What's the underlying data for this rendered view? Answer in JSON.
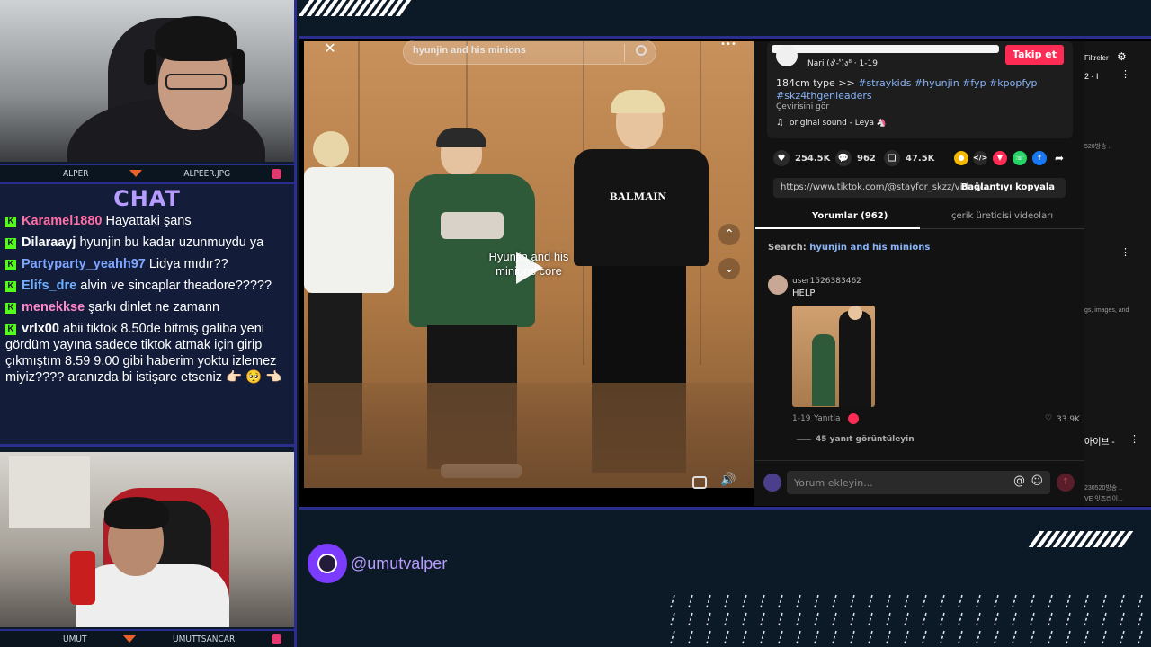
{
  "cams": {
    "top": {
      "left_label": "ALPER",
      "right_label": "ALPEER.JPG"
    },
    "bottom": {
      "left_label": "UMUT",
      "right_label": "UMUTTSANCAR"
    }
  },
  "chat": {
    "title": "CHAT",
    "messages": [
      {
        "user": "Karamel1880",
        "color": "#ff6fa5",
        "text": "Hayattaki şans"
      },
      {
        "user": "Dilaraayj",
        "color": "#ffffff",
        "text": "hyunjin bu kadar uzunmuydu ya"
      },
      {
        "user": "Partyparty_yeahh97",
        "color": "#7ea6ff",
        "text": "Lidya mıdır??"
      },
      {
        "user": "Elifs_dre",
        "color": "#6fb0ff",
        "text": "alvin ve sincaplar theadore?????"
      },
      {
        "user": "menekkse",
        "color": "#ff88c8",
        "text": "şarkı dinlet ne zamann"
      },
      {
        "user": "vrlx00",
        "color": "#ffffff",
        "text": "abii tiktok 8.50de bitmiş galiba yeni gördüm yayına sadece tiktok atmak için girip çıkmıştım 8.59 9.00 gibi haberim yoktu izlemez miyiz???? aranızda bi istişare etseniz 👉🏻 🥺 👈🏻"
      }
    ]
  },
  "video": {
    "search_text": "hyunjin and his minions",
    "caption": "Hyunjin and his minions core",
    "close_glyph": "✕",
    "more_glyph": "•••"
  },
  "tiktok": {
    "author_meta": "Nari (ง'̀-'́)ง⁸ · 1-19",
    "follow_label": "Takip et",
    "description_text": "184cm type >> ",
    "hashtags_line1": "#straykids #hyunjin #fyp #kpopfyp",
    "hashtags_line2": "#skz4thgenleaders",
    "translate_label": "Çevirisini gör",
    "sound": "original sound - Leya 🦄",
    "stats": {
      "likes": "254.5K",
      "comments": "962",
      "saves": "47.5K"
    },
    "url": "https://www.tiktok.com/@stayfor_skzz/video/...",
    "copy_link": "Bağlantıyı kopyala",
    "tabs": {
      "comments": "Yorumlar (962)",
      "creator": "İçerik üreticisi videoları"
    },
    "search_prefix": "Search: ",
    "search_query": "hyunjin and his minions",
    "comment": {
      "user": "user1526383462",
      "text": "HELP",
      "date": "1-19",
      "reply": "Yanıtla",
      "likes": "33.9K",
      "view_replies": "45 yanıt görüntüleyin"
    },
    "input_placeholder": "Yorum ekleyin..."
  },
  "farright": {
    "filters": "Filtreler",
    "t1": "2 - I",
    "t2": "520방송 .",
    "t3": "gs, images, and",
    "t4": "아이브 -",
    "t5": "230520방송 ..",
    "t6": "VE 잇즈라이..."
  },
  "footer": {
    "handle": "@umutvalper"
  }
}
